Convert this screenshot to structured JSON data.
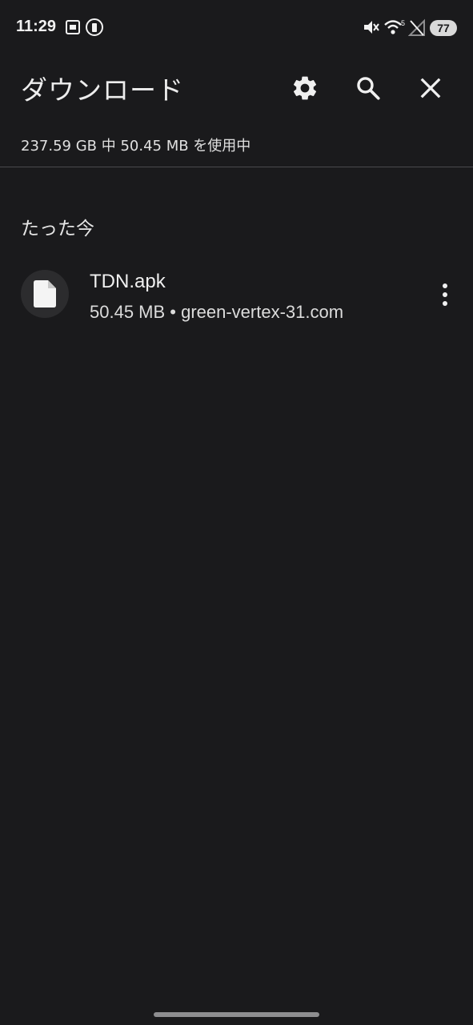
{
  "status_bar": {
    "time": "11:29",
    "battery_level": "77",
    "icons": [
      "screenshot-icon",
      "battery-saver-icon",
      "mute-icon",
      "wifi-icon",
      "no-signal-icon"
    ]
  },
  "app_bar": {
    "title": "ダウンロード",
    "actions": [
      "settings-icon",
      "search-icon",
      "close-icon"
    ]
  },
  "storage": {
    "text": "237.59 GB 中 50.45 MB を使用中"
  },
  "sections": [
    {
      "header": "たった今",
      "items": [
        {
          "name": "TDN.apk",
          "meta": "50.45 MB • green-vertex-31.com",
          "icon": "file-icon"
        }
      ]
    }
  ],
  "colors": {
    "background": "#1a1a1c",
    "text": "#e8e8ea",
    "divider": "#4a4a4d",
    "avatar_bg": "#2c2c2e"
  }
}
